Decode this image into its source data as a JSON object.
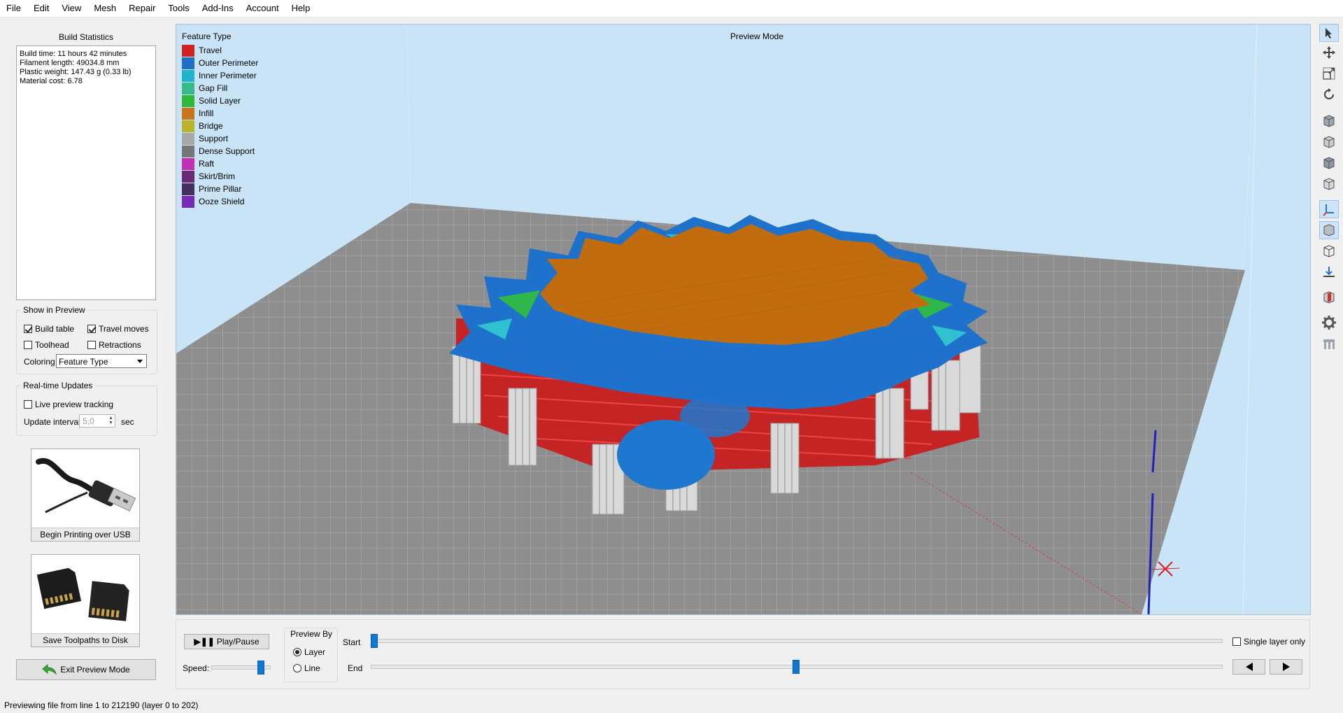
{
  "menu": [
    "File",
    "Edit",
    "View",
    "Mesh",
    "Repair",
    "Tools",
    "Add-Ins",
    "Account",
    "Help"
  ],
  "build_stats": {
    "title": "Build Statistics",
    "lines": [
      "Build time: 11 hours 42 minutes",
      "Filament length: 49034.8 mm",
      "Plastic weight: 147.43 g (0.33 lb)",
      "Material cost: 6.78"
    ]
  },
  "show_in_preview": {
    "title": "Show in Preview",
    "build_table": {
      "label": "Build table",
      "checked": true
    },
    "travel_moves": {
      "label": "Travel moves",
      "checked": true
    },
    "toolhead": {
      "label": "Toolhead",
      "checked": false
    },
    "retractions": {
      "label": "Retractions",
      "checked": false
    },
    "coloring_label": "Coloring",
    "coloring_value": "Feature Type"
  },
  "realtime": {
    "title": "Real-time Updates",
    "live_tracking": {
      "label": "Live preview tracking",
      "checked": false
    },
    "interval_label": "Update interval",
    "interval_value": "5,0",
    "interval_unit": "sec"
  },
  "usb_button": {
    "label": "Begin Printing over USB"
  },
  "sd_button": {
    "label": "Save Toolpaths to Disk"
  },
  "exit_button": {
    "label": "Exit Preview Mode"
  },
  "viewport": {
    "mode_label": "Preview Mode",
    "legend_title": "Feature Type",
    "legend": [
      {
        "label": "Travel",
        "color": "#d32222"
      },
      {
        "label": "Outer Perimeter",
        "color": "#1f6fc6"
      },
      {
        "label": "Inner Perimeter",
        "color": "#22b3c9"
      },
      {
        "label": "Gap Fill",
        "color": "#38b98a"
      },
      {
        "label": "Solid Layer",
        "color": "#30b83a"
      },
      {
        "label": "Infill",
        "color": "#c77619"
      },
      {
        "label": "Bridge",
        "color": "#b9b32a"
      },
      {
        "label": "Support",
        "color": "#a8a8a8"
      },
      {
        "label": "Dense Support",
        "color": "#777777"
      },
      {
        "label": "Raft",
        "color": "#c22fb2"
      },
      {
        "label": "Skirt/Brim",
        "color": "#6b2a74"
      },
      {
        "label": "Prime Pillar",
        "color": "#43305e"
      },
      {
        "label": "Ooze Shield",
        "color": "#7a2bb6"
      }
    ]
  },
  "playback": {
    "play_label": "Play/Pause",
    "speed_label": "Speed:",
    "speed_fraction": 0.9,
    "preview_by": {
      "title": "Preview By",
      "layer": "Layer",
      "line": "Line",
      "selected": "Layer"
    },
    "start_label": "Start",
    "end_label": "End",
    "start_fraction": 0.0,
    "end_fraction": 0.5,
    "single_layer": {
      "label": "Single layer only",
      "checked": false
    }
  },
  "status": "Previewing file from line 1 to 212190 (layer 0 to 202)"
}
